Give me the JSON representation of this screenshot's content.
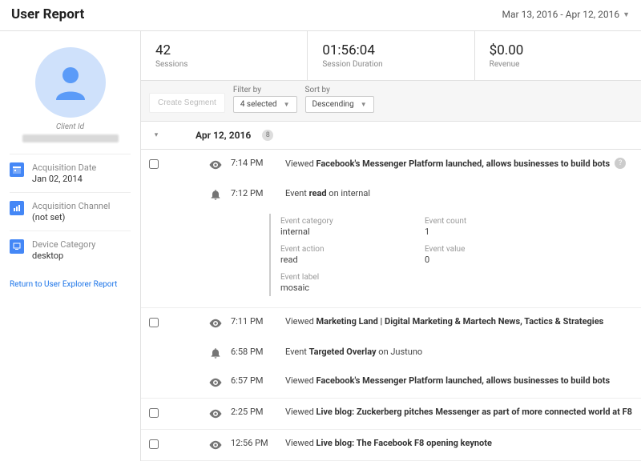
{
  "header": {
    "title": "User Report",
    "date_range": "Mar 13, 2016 - Apr 12, 2016"
  },
  "sidebar": {
    "client_id_label": "Client Id",
    "props": [
      {
        "icon": "calendar",
        "label": "Acquisition Date",
        "value": "Jan 02, 2014"
      },
      {
        "icon": "bars",
        "label": "Acquisition Channel",
        "value": "(not set)"
      },
      {
        "icon": "device",
        "label": "Device Category",
        "value": "desktop"
      }
    ],
    "return_link": "Return to User Explorer Report"
  },
  "stats": [
    {
      "value": "42",
      "label": "Sessions"
    },
    {
      "value": "01:56:04",
      "label": "Session Duration"
    },
    {
      "value": "$0.00",
      "label": "Revenue"
    }
  ],
  "controls": {
    "create_segment": "Create Segment",
    "filter_label": "Filter by",
    "filter_value": "4 selected",
    "sort_label": "Sort by",
    "sort_value": "Descending"
  },
  "date_group": {
    "date": "Apr 12, 2016",
    "count": "8"
  },
  "activities": [
    {
      "type": "view",
      "time": "7:14 PM",
      "prefix": "Viewed ",
      "bold": "Facebook's Messenger Platform launched, allows businesses to build bots",
      "suffix": "",
      "has_info": true,
      "has_checkbox": true
    },
    {
      "type": "event",
      "time": "7:12 PM",
      "prefix": "Event ",
      "bold": "read",
      "suffix": " on internal",
      "has_info": false,
      "has_checkbox": false,
      "detail": {
        "category_label": "Event category",
        "category_value": "internal",
        "count_label": "Event count",
        "count_value": "1",
        "action_label": "Event action",
        "action_value": "read",
        "value_label": "Event value",
        "value_value": "0",
        "label_label": "Event label",
        "label_value": "mosaic"
      }
    },
    {
      "type": "view",
      "time": "7:11 PM",
      "prefix": "Viewed ",
      "bold": "Marketing Land | Digital Marketing & Martech News, Tactics & Strategies",
      "suffix": "",
      "has_info": false,
      "has_checkbox": true
    },
    {
      "type": "event",
      "time": "6:58 PM",
      "prefix": "Event ",
      "bold": "Targeted Overlay",
      "suffix": " on Justuno",
      "has_info": false,
      "has_checkbox": false
    },
    {
      "type": "view",
      "time": "6:57 PM",
      "prefix": "Viewed ",
      "bold": "Facebook's Messenger Platform launched, allows businesses to build bots",
      "suffix": "",
      "has_info": false,
      "has_checkbox": false
    },
    {
      "type": "view",
      "time": "2:25 PM",
      "prefix": "Viewed ",
      "bold": "Live blog: Zuckerberg pitches Messenger as part of more connected world at F8",
      "suffix": "",
      "has_info": false,
      "has_checkbox": true
    },
    {
      "type": "view",
      "time": "12:56 PM",
      "prefix": "Viewed ",
      "bold": "Live blog: The Facebook F8 opening keynote",
      "suffix": "",
      "has_info": false,
      "has_checkbox": true
    }
  ]
}
